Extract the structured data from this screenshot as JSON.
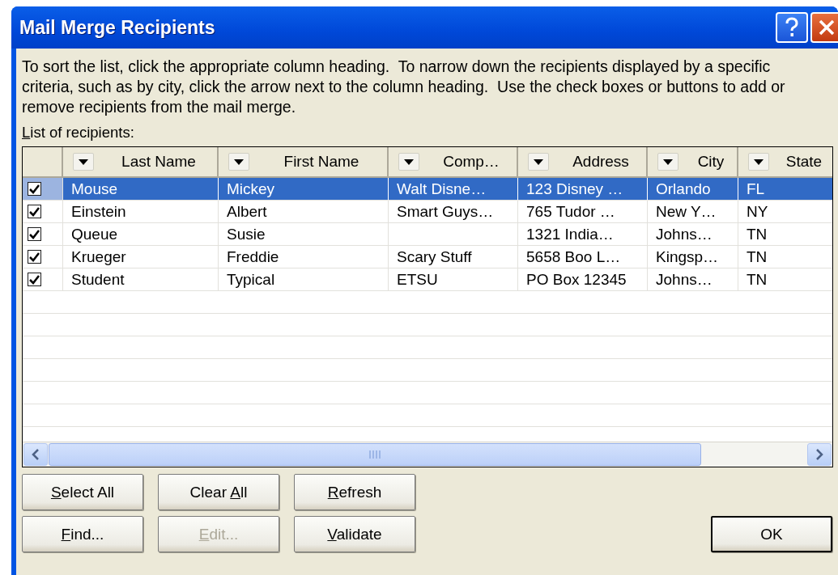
{
  "window": {
    "title": "Mail Merge Recipients"
  },
  "description": "To sort the list, click the appropriate column heading.  To narrow down the recipients displayed by a specific criteria, such as by city, click the arrow next to the column heading.  Use the check boxes or buttons to add or remove recipients from the mail merge.",
  "list_label": {
    "key": "L",
    "rest": "ist of recipients:"
  },
  "table": {
    "columns": [
      {
        "label": "Last Name"
      },
      {
        "label": "First Name"
      },
      {
        "label": "Comp…"
      },
      {
        "label": "Address"
      },
      {
        "label": "City"
      },
      {
        "label": "State"
      }
    ],
    "rows": [
      {
        "checked": true,
        "selected": true,
        "cells": [
          "Mouse",
          "Mickey",
          "Walt Disne…",
          "123 Disney …",
          "Orlando",
          "FL"
        ]
      },
      {
        "checked": true,
        "selected": false,
        "cells": [
          "Einstein",
          "Albert",
          "Smart Guys…",
          "765 Tudor …",
          "New Y…",
          "NY"
        ]
      },
      {
        "checked": true,
        "selected": false,
        "cells": [
          "Queue",
          "Susie",
          null,
          "1321 India…",
          "Johns…",
          "TN"
        ]
      },
      {
        "checked": true,
        "selected": false,
        "cells": [
          "Krueger",
          "Freddie",
          "Scary Stuff",
          "5658 Boo L…",
          "Kingsp…",
          "TN"
        ]
      },
      {
        "checked": true,
        "selected": false,
        "cells": [
          "Student",
          "Typical",
          "ETSU",
          "PO Box 12345",
          "Johns…",
          "TN"
        ]
      }
    ]
  },
  "buttons": [
    {
      "key": "S",
      "after": "elect All",
      "disabled": false,
      "default": false
    },
    {
      "before": "Clear ",
      "key": "A",
      "after": "ll",
      "disabled": false,
      "default": false
    },
    {
      "key": "R",
      "after": "efresh",
      "disabled": false,
      "default": false
    },
    {
      "key": "F",
      "after": "ind...",
      "disabled": false,
      "default": false
    },
    {
      "key": "E",
      "after": "dit...",
      "disabled": true,
      "default": false
    },
    {
      "key": "V",
      "after": "alidate",
      "disabled": false,
      "default": false
    }
  ],
  "ok_button": {
    "label": "OK",
    "default": true
  }
}
